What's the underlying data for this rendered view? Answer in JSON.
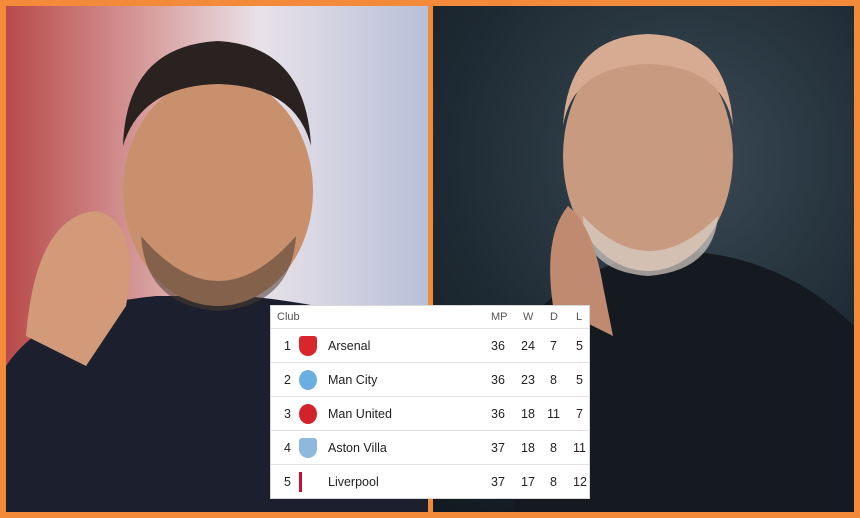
{
  "table": {
    "headers": {
      "club": "Club",
      "mp": "MP",
      "w": "W",
      "d": "D",
      "l": "L"
    },
    "rows": [
      {
        "pos": "1",
        "club": "Arsenal",
        "mp": "36",
        "w": "24",
        "d": "7",
        "l": "5",
        "badge_color": "#d8262b",
        "badge_icon": "arsenal-crest"
      },
      {
        "pos": "2",
        "club": "Man City",
        "mp": "36",
        "w": "23",
        "d": "8",
        "l": "5",
        "badge_color": "#6caee0",
        "badge_icon": "man-city-crest"
      },
      {
        "pos": "3",
        "club": "Man United",
        "mp": "36",
        "w": "18",
        "d": "11",
        "l": "7",
        "badge_color": "#d3232a",
        "badge_icon": "man-united-crest"
      },
      {
        "pos": "4",
        "club": "Aston Villa",
        "mp": "37",
        "w": "18",
        "d": "8",
        "l": "11",
        "badge_color": "#8fb8de",
        "badge_icon": "aston-villa-crest"
      },
      {
        "pos": "5",
        "club": "Liverpool",
        "mp": "37",
        "w": "17",
        "d": "8",
        "l": "12",
        "badge_color": "#c8102e",
        "badge_icon": "liverpool-crest"
      }
    ]
  },
  "colors": {
    "border": "#f28a3a"
  }
}
